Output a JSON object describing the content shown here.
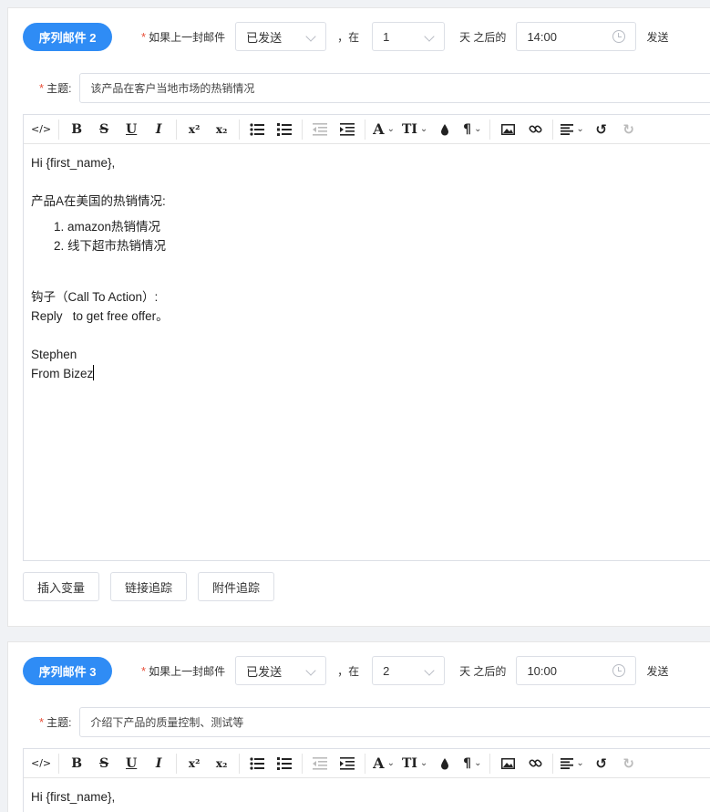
{
  "sequence_emails": [
    {
      "badge": "序列邮件 2",
      "cond_label": "如果上一封邮件",
      "status": "已发送",
      "comma_at": "，在",
      "days": "1",
      "days_after": "天 之后的",
      "time": "14:00",
      "send": "发送",
      "subject_label": "主题:",
      "subject": "该产品在客户当地市场的热销情况",
      "body": {
        "greeting": "Hi {first_name},",
        "intro": "产品A在美国的热销情况:",
        "list": [
          "amazon热销情况",
          "线下超市热销情况"
        ],
        "cta": "钩子（Call To Action）:",
        "reply": "Reply   to get free offer。",
        "sign1": "Stephen",
        "sign2": "From Bizez"
      },
      "buttons": [
        "插入变量",
        "链接追踪",
        "附件追踪"
      ]
    },
    {
      "badge": "序列邮件 3",
      "cond_label": "如果上一封邮件",
      "status": "已发送",
      "comma_at": "，在",
      "days": "2",
      "days_after": "天 之后的",
      "time": "10:00",
      "send": "发送",
      "subject_label": "主题:",
      "subject": "介绍下产品的质量控制、测试等",
      "body": {
        "greeting": "Hi {first_name},"
      }
    }
  ],
  "toolbar_icons": [
    "code-view-icon",
    "bold-icon",
    "strikethrough-icon",
    "underline-icon",
    "italic-icon",
    "superscript-icon",
    "subscript-icon",
    "bullet-list-icon",
    "numbered-list-icon",
    "outdent-icon",
    "indent-icon",
    "font-size-icon",
    "text-style-icon",
    "text-color-icon",
    "paragraph-icon",
    "image-icon",
    "link-icon",
    "align-icon",
    "undo-icon",
    "redo-icon"
  ],
  "toolbar_glyphs": {
    "code": "</>",
    "bold": "B",
    "strike": "S",
    "underline": "U",
    "italic": "I",
    "sup": "x²",
    "sub": "x₂",
    "font": "A",
    "text": "TI"
  },
  "colors": {
    "badge": "#2f8cf5",
    "required": "#e8503a",
    "border": "#dcdfe6"
  }
}
